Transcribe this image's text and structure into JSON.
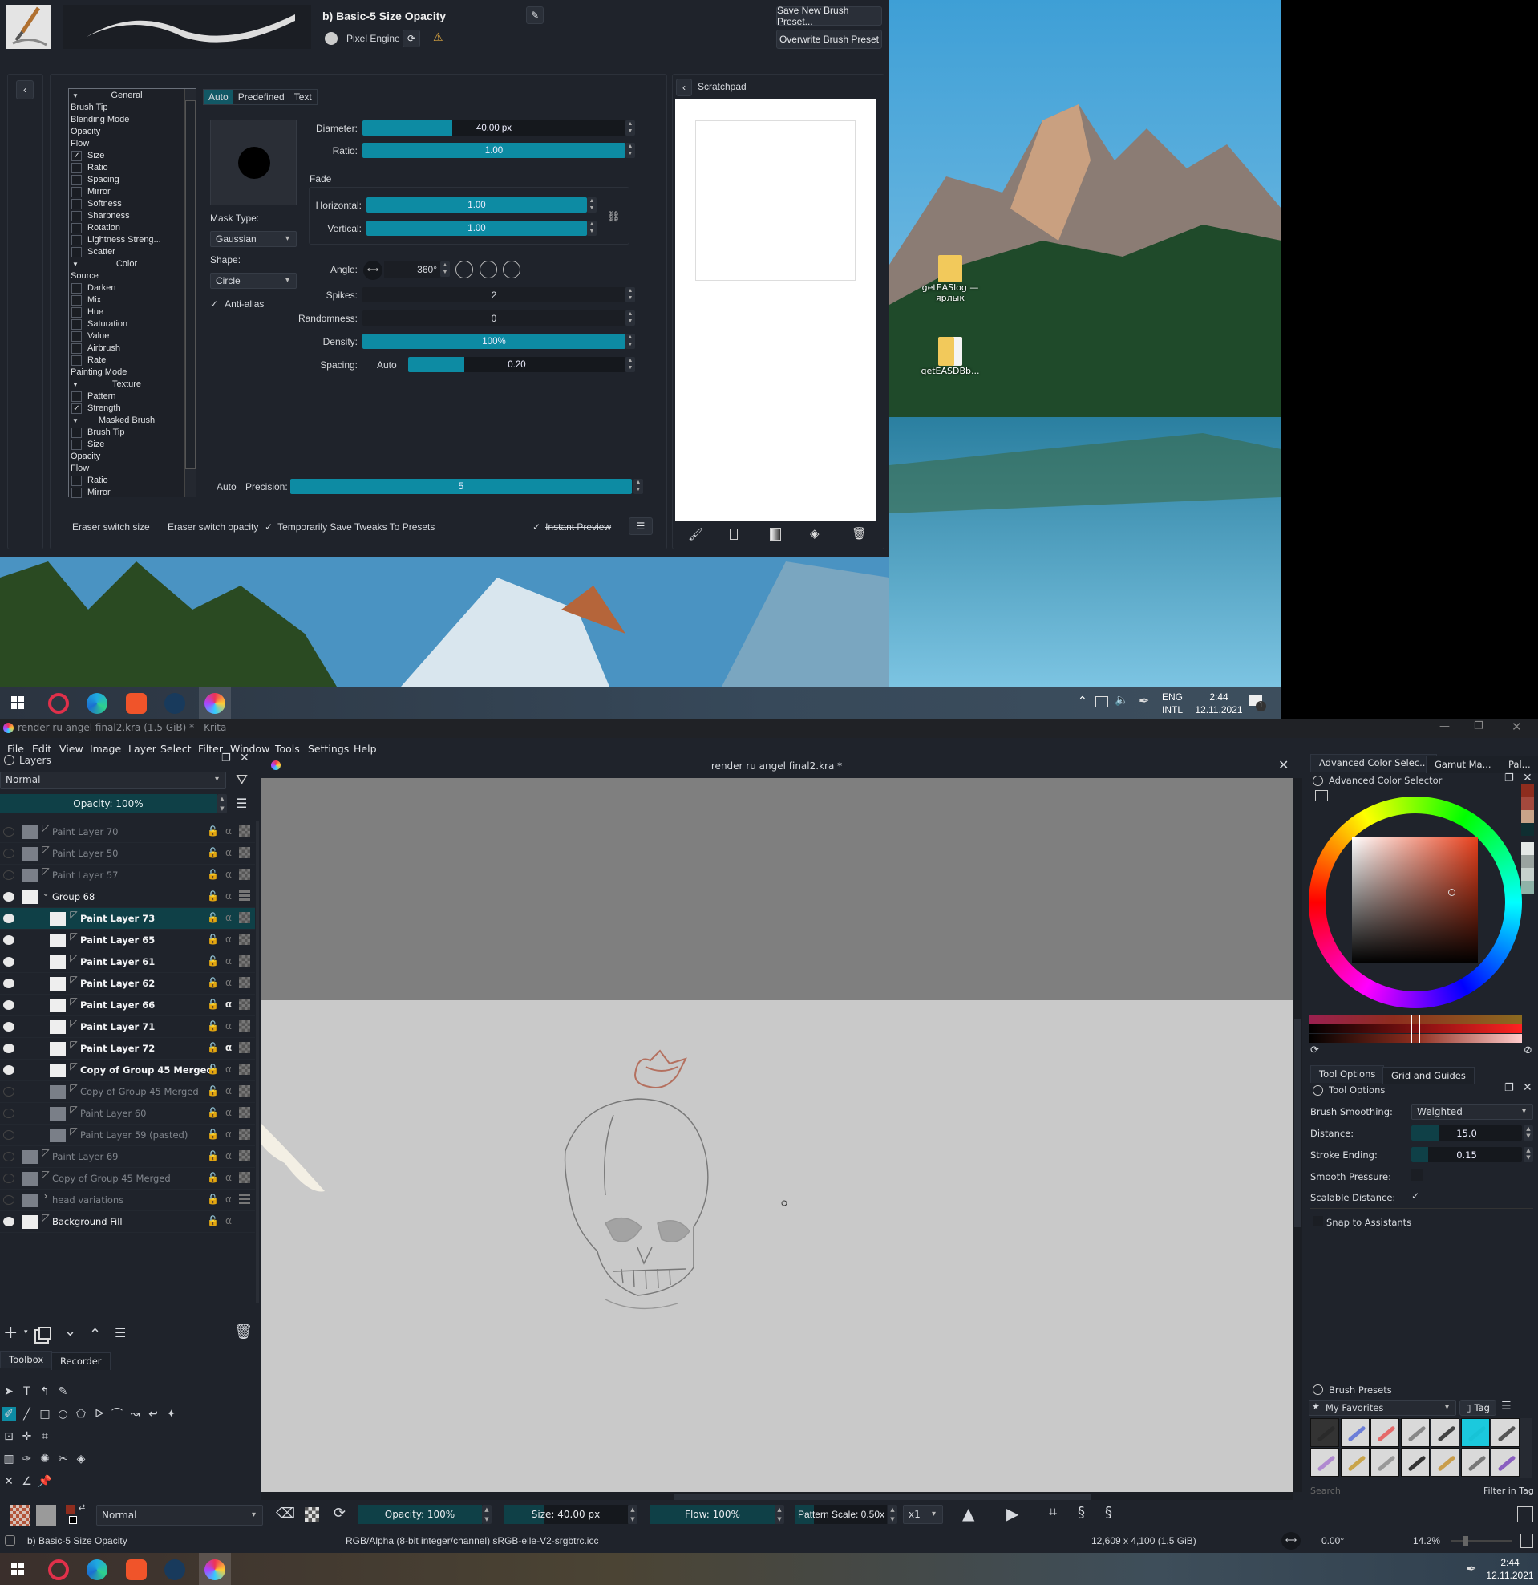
{
  "brush_editor": {
    "preset_name": "b) Basic-5 Size Opacity",
    "engine": "Pixel Engine",
    "save_new": "Save New Brush Preset...",
    "overwrite": "Overwrite Brush Preset",
    "options": [
      {
        "label": "General",
        "kind": "header"
      },
      {
        "label": "Brush Tip",
        "kind": "plain"
      },
      {
        "label": "Blending Mode",
        "kind": "plain"
      },
      {
        "label": "Opacity",
        "kind": "plain"
      },
      {
        "label": "Flow",
        "kind": "plain"
      },
      {
        "label": "Size",
        "kind": "check",
        "checked": true
      },
      {
        "label": "Ratio",
        "kind": "check",
        "checked": false
      },
      {
        "label": "Spacing",
        "kind": "check",
        "checked": false
      },
      {
        "label": "Mirror",
        "kind": "check",
        "checked": false
      },
      {
        "label": "Softness",
        "kind": "check",
        "checked": false
      },
      {
        "label": "Sharpness",
        "kind": "check",
        "checked": false
      },
      {
        "label": "Rotation",
        "kind": "check",
        "checked": false
      },
      {
        "label": "Lightness Streng...",
        "kind": "check",
        "checked": false
      },
      {
        "label": "Scatter",
        "kind": "check",
        "checked": false
      },
      {
        "label": "Color",
        "kind": "header"
      },
      {
        "label": "Source",
        "kind": "plain"
      },
      {
        "label": "Darken",
        "kind": "check",
        "checked": false
      },
      {
        "label": "Mix",
        "kind": "check",
        "checked": false
      },
      {
        "label": "Hue",
        "kind": "check",
        "checked": false
      },
      {
        "label": "Saturation",
        "kind": "check",
        "checked": false
      },
      {
        "label": "Value",
        "kind": "check",
        "checked": false
      },
      {
        "label": "Airbrush",
        "kind": "check",
        "checked": false
      },
      {
        "label": "Rate",
        "kind": "check",
        "checked": false
      },
      {
        "label": "Painting Mode",
        "kind": "plain"
      },
      {
        "label": "Texture",
        "kind": "header"
      },
      {
        "label": "Pattern",
        "kind": "check",
        "checked": false
      },
      {
        "label": "Strength",
        "kind": "check",
        "checked": true
      },
      {
        "label": "Masked Brush",
        "kind": "header"
      },
      {
        "label": "Brush Tip",
        "kind": "check",
        "checked": false
      },
      {
        "label": "Size",
        "kind": "check",
        "checked": false
      },
      {
        "label": "Opacity",
        "kind": "plain"
      },
      {
        "label": "Flow",
        "kind": "plain"
      },
      {
        "label": "Ratio",
        "kind": "check",
        "checked": false
      },
      {
        "label": "Mirror",
        "kind": "check",
        "checked": false
      }
    ],
    "tip_tabs": [
      "Auto",
      "Predefined",
      "Text"
    ],
    "active_tip_tab": 0,
    "mask_type_label": "Mask Type:",
    "mask_type": "Gaussian",
    "shape_label": "Shape:",
    "shape": "Circle",
    "anti_alias": "Anti-alias",
    "anti_alias_checked": true,
    "check_mark": "✓",
    "diameter": {
      "label": "Diameter:",
      "value": "40.00 px",
      "fill": 0.34
    },
    "ratio": {
      "label": "Ratio:",
      "value": "1.00",
      "fill": 1.0
    },
    "fade_label": "Fade",
    "horizontal": {
      "label": "Horizontal:",
      "value": "1.00",
      "fill": 1.0
    },
    "vertical": {
      "label": "Vertical:",
      "value": "1.00",
      "fill": 1.0
    },
    "angle": {
      "label": "Angle:",
      "value": "360°"
    },
    "spikes": {
      "label": "Spikes:",
      "value": "2"
    },
    "randomness": {
      "label": "Randomness:",
      "value": "0"
    },
    "density": {
      "label": "Density:",
      "value": "100%",
      "fill": 1.0
    },
    "spacing": {
      "label": "Spacing:",
      "auto": "Auto",
      "value": "0.20",
      "fill": 0.26
    },
    "precision": {
      "auto": "Auto",
      "label": "Precision:",
      "value": "5",
      "fill": 1.0
    },
    "eraser_size": "Eraser switch size",
    "eraser_opacity": "Eraser switch opacity",
    "temp_save": "Temporarily Save Tweaks To Presets",
    "instant_preview": "Instant Preview",
    "scratchpad_title": "Scratchpad"
  },
  "desktop": {
    "icons": [
      "getEASlog — ярлык",
      "getEASDBb..."
    ]
  },
  "taskbar_top": {
    "lang1": "ENG",
    "lang2": "INTL",
    "time": "2:44",
    "date": "12.11.2021",
    "notifications": "1"
  },
  "taskbar_bottom": {
    "time": "2:44",
    "date": "12.11.2021"
  },
  "krita": {
    "window_title": "render ru angel final2.kra (1.5 GiB)  * - Krita",
    "menu": [
      "File",
      "Edit",
      "View",
      "Image",
      "Layer",
      "Select",
      "Filter",
      "Window",
      "Tools",
      "Settings",
      "Help"
    ],
    "layers": {
      "title": "Layers",
      "blend_mode": "Normal",
      "opacity": "Opacity:  100%",
      "rows": [
        {
          "name": "Paint Layer 70",
          "visible": false,
          "child": false,
          "type": "paint"
        },
        {
          "name": "Paint Layer 50",
          "visible": false,
          "child": false,
          "type": "paint"
        },
        {
          "name": "Paint Layer 57",
          "visible": false,
          "child": false,
          "type": "paint"
        },
        {
          "name": "Group 68",
          "visible": true,
          "child": false,
          "type": "group",
          "expanded": true
        },
        {
          "name": "Paint Layer 73",
          "visible": true,
          "child": true,
          "type": "paint",
          "selected": true
        },
        {
          "name": "Paint Layer 65",
          "visible": true,
          "child": true,
          "type": "paint"
        },
        {
          "name": "Paint Layer 61",
          "visible": true,
          "child": true,
          "type": "paint"
        },
        {
          "name": "Paint Layer 62",
          "visible": true,
          "child": true,
          "type": "paint"
        },
        {
          "name": "Paint Layer 66",
          "visible": true,
          "child": true,
          "type": "paint",
          "inherit_alpha": true
        },
        {
          "name": "Paint Layer 71",
          "visible": true,
          "child": true,
          "type": "paint"
        },
        {
          "name": "Paint Layer 72",
          "visible": true,
          "child": true,
          "type": "paint",
          "inherit_alpha": true
        },
        {
          "name": "Copy of Group 45 Merged",
          "visible": true,
          "child": true,
          "type": "paint"
        },
        {
          "name": "Copy of Group 45 Merged",
          "visible": false,
          "child": true,
          "type": "paint"
        },
        {
          "name": "Paint Layer 60",
          "visible": false,
          "child": true,
          "type": "paint"
        },
        {
          "name": "Paint Layer 59 (pasted)",
          "visible": false,
          "child": true,
          "type": "paint"
        },
        {
          "name": "Paint Layer 69",
          "visible": false,
          "child": false,
          "type": "paint"
        },
        {
          "name": "Copy of Group 45 Merged",
          "visible": false,
          "child": false,
          "type": "paint"
        },
        {
          "name": "head variations",
          "visible": false,
          "child": false,
          "type": "group",
          "expanded": false
        },
        {
          "name": "Background Fill",
          "visible": true,
          "child": false,
          "type": "fill",
          "locked": true
        }
      ]
    },
    "toolbox_tabs": [
      "Toolbox",
      "Recorder"
    ],
    "canvas_title": "render ru angel final2.kra *",
    "color_tabs": [
      "Advanced Color Selec...",
      "Gamut Ma...",
      "Pal..."
    ],
    "color_title": "Advanced Color Selector",
    "colors": {
      "hue": "#e8401c",
      "history": [
        "#8e2d1e",
        "#a4493d",
        "#c9a489",
        "#0f2e31",
        "#e4e8e6",
        "#9aa3a0",
        "#c7d1cd",
        "#8fb3a8"
      ]
    },
    "tool_tabs": [
      "Tool Options",
      "Grid and Guides"
    ],
    "tool_title": "Tool Options",
    "brush_smoothing": {
      "label": "Brush Smoothing:",
      "value": "Weighted"
    },
    "distance": {
      "label": "Distance:",
      "value": "15.0",
      "fill": 0.25
    },
    "stroke_ending": {
      "label": "Stroke Ending:",
      "value": "0.15",
      "fill": 0.15
    },
    "smooth_pressure": {
      "label": "Smooth Pressure:",
      "checked": false
    },
    "scalable_distance": {
      "label": "Scalable Distance:",
      "checked": true
    },
    "snap": {
      "label": "Snap to Assistants",
      "checked": false
    },
    "presets_title": "Brush Presets",
    "presets_tag": "My Favorites",
    "presets_tag_btn": "Tag",
    "presets_search": "Search",
    "presets_filter": "Filter in Tag",
    "toolbar": {
      "blend_mode": "Normal",
      "opacity": "Opacity: 100%",
      "size": "Size: 40.00 px",
      "size_fill": 0.32,
      "flow": "Flow: 100%",
      "pattern_scale": "Pattern Scale: 0.50x",
      "multiplier": "x1"
    },
    "status": {
      "preset": "b) Basic-5 Size Opacity",
      "color_space": "RGB/Alpha (8-bit integer/channel)  sRGB-elle-V2-srgbtrc.icc",
      "dimensions": "12,609 x 4,100 (1.5 GiB)",
      "rotation": "0.00°",
      "zoom": "14.2%"
    }
  }
}
